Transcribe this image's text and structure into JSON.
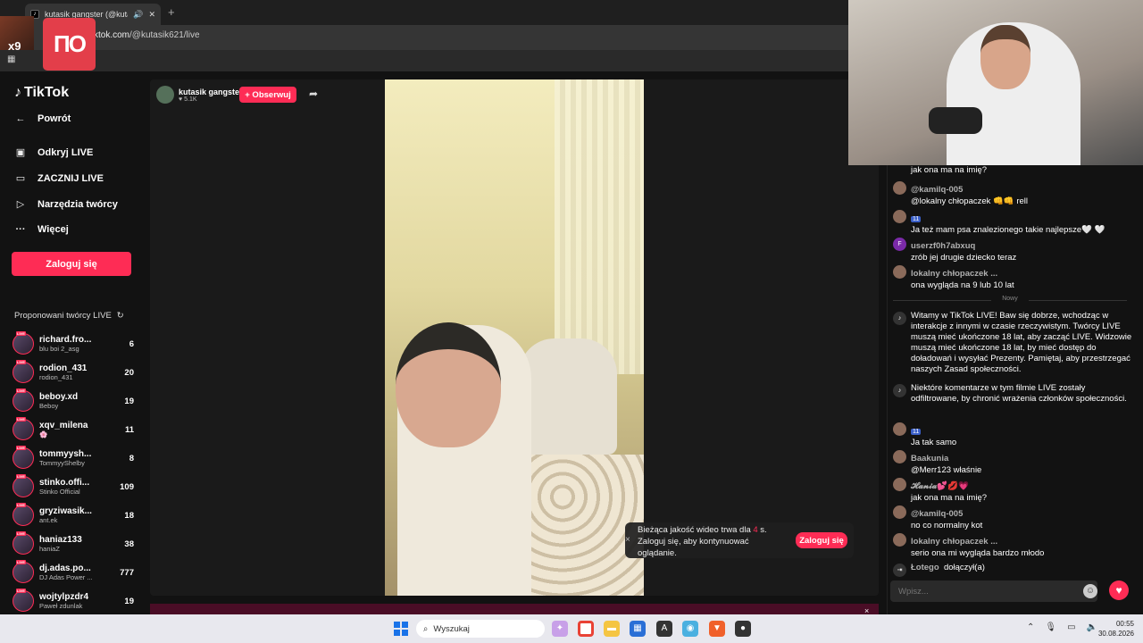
{
  "browser": {
    "tab_title": "kutasik gangster (@kutasik...",
    "new_tab": "+",
    "url_host": "tiktok.com",
    "url_path": "/@kutasik621/live"
  },
  "overlay": {
    "logo_text": "ПО",
    "badge_text": "x9"
  },
  "sidebar": {
    "brand": "TikTok",
    "back": "Powrót",
    "nav": [
      {
        "label": "Odkryj LIVE"
      },
      {
        "label": "ZACZNIJ LIVE"
      },
      {
        "label": "Narzędzia twórcy"
      },
      {
        "label": "Więcej"
      }
    ],
    "login": "Zaloguj się",
    "suggested_title": "Proponowani twórcy LIVE",
    "live_tag": "LIVE",
    "creators": [
      {
        "name": "richard.fro...",
        "sub": "blu boi 2_asg",
        "count": "6"
      },
      {
        "name": "rodion_431",
        "sub": "rodion_431",
        "count": "20"
      },
      {
        "name": "beboy.xd",
        "sub": "Beboy",
        "count": "19"
      },
      {
        "name": "xqv_milena",
        "sub": "🌸",
        "count": "11"
      },
      {
        "name": "tommyysh...",
        "sub": "TommyyShelby",
        "count": "8"
      },
      {
        "name": "stinko.offi...",
        "sub": "Stinko Official",
        "count": "109"
      },
      {
        "name": "gryziwasik...",
        "sub": "ant.ek",
        "count": "18"
      },
      {
        "name": "haniaz133",
        "sub": "haniaZ",
        "count": "38"
      },
      {
        "name": "dj.adas.po...",
        "sub": "DJ Adas Power ...",
        "count": "777"
      },
      {
        "name": "wojtylpzdr4",
        "sub": "Paweł zdunlak",
        "count": "19"
      }
    ]
  },
  "stream": {
    "streamer_name": "kutasik gangster",
    "likes": "♥ 5.1K",
    "follow": "+ Obserwuj",
    "quality_prefix": "Bieżąca jakość wideo trwa dla ",
    "quality_seconds": "4",
    "quality_suffix": " s. Zaloguj się, aby kontynuować oglądanie.",
    "quality_login": "Zaloguj się",
    "close": "×"
  },
  "chat": {
    "top_text": "jak ona ma na imię?",
    "messages": [
      {
        "user": "@kamilq-005",
        "text": "@lokalny chłopaczek 👊👊 rell"
      },
      {
        "badge": "11",
        "user": "",
        "text": "Ja też mam psa znalezionego takie najlepsze🤍 🤍"
      },
      {
        "user": "userzf0h7abxuq",
        "text": "zrób jej drugie dziecko teraz",
        "initial": "F"
      },
      {
        "user": "lokalny chłopaczek ...",
        "text": "ona wygląda na 9 lub 10 lat"
      }
    ],
    "divider": "Nowy",
    "system": [
      "Witamy w TikTok LIVE! Baw się dobrze, wchodząc w interakcje z innymi w czasie rzeczywistym. Twórcy LIVE muszą mieć ukończone 18 lat, aby zacząć LIVE. Widzowie muszą mieć ukończone 18 lat, by mieć dostęp do doładowań i wysyłać Prezenty. Pamiętaj, aby przestrzegać naszych Zasad społeczności.",
      "Niektóre komentarze w tym filmie LIVE zostały odfiltrowane, by chronić wrażenia członków społeczności."
    ],
    "messages2": [
      {
        "badge": "11",
        "user": "",
        "text": "Ja tak samo"
      },
      {
        "user": "Baakunia",
        "text": "@Merr123 właśnie"
      },
      {
        "user": "𝓗𝓪𝓷𝓲𝓪💕💋💗",
        "text": "jak ona ma na imię?"
      },
      {
        "user": "@kamilq-005",
        "text": "no co normalny kot"
      },
      {
        "user": "lokalny chłopaczek ...",
        "text": "serio ona mi wygląda bardzo młodo"
      }
    ],
    "join_user": "Łotego",
    "join_text": "dołączył(a)",
    "input_placeholder": "Wpisz..."
  },
  "taskbar": {
    "search": "Wyszukaj",
    "time": "00:55",
    "date": "30.08.2026"
  }
}
